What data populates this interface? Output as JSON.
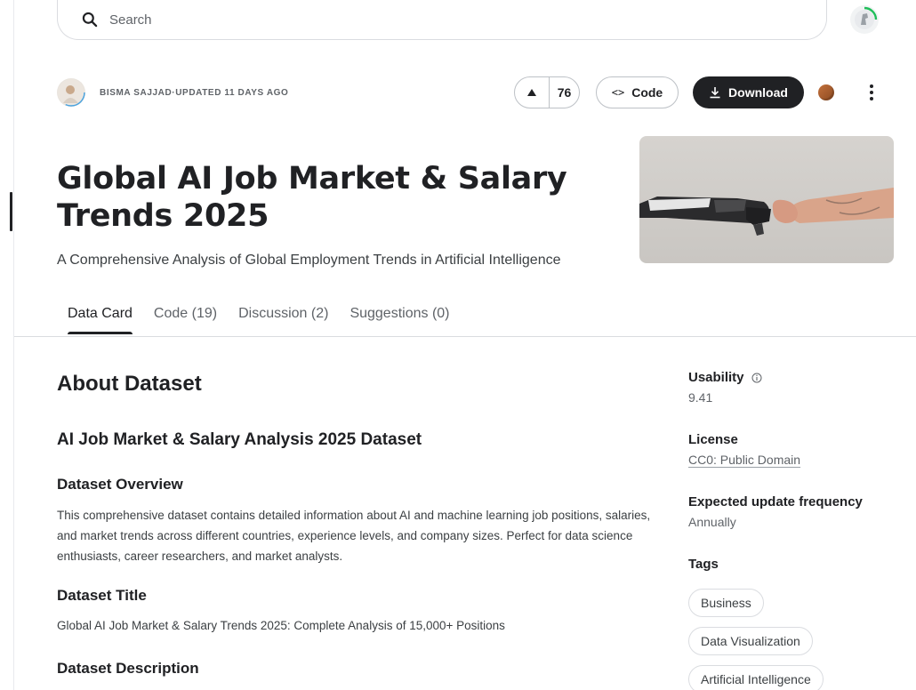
{
  "search": {
    "placeholder": "Search"
  },
  "header": {
    "author": "BISMA SAJJAD",
    "updated": "UPDATED 11 DAYS AGO",
    "separator": " · ",
    "votes": "76",
    "code_label": "Code",
    "download_label": "Download"
  },
  "dataset": {
    "title": "Global AI Job Market & Salary Trends 2025",
    "subtitle": "A Comprehensive Analysis of Global Employment Trends in Artificial Intelligence"
  },
  "tabs": [
    {
      "label": "Data Card",
      "active": true
    },
    {
      "label": "Code (19)",
      "active": false
    },
    {
      "label": "Discussion (2)",
      "active": false
    },
    {
      "label": "Suggestions (0)",
      "active": false
    }
  ],
  "content": {
    "about_heading": "About Dataset",
    "dataset_heading": "AI Job Market & Salary Analysis 2025 Dataset",
    "overview_heading": "Dataset Overview",
    "overview_text": "This comprehensive dataset contains detailed information about AI and machine learning job positions, salaries, and market trends across different countries, experience levels, and company sizes. Perfect for data science enthusiasts, career researchers, and market analysts.",
    "title_heading": "Dataset Title",
    "title_text": "Global AI Job Market & Salary Trends 2025: Complete Analysis of 15,000+ Positions",
    "description_heading": "Dataset Description"
  },
  "sidebar": {
    "usability_label": "Usability",
    "usability_value": "9.41",
    "license_label": "License",
    "license_value": "CC0: Public Domain",
    "frequency_label": "Expected update frequency",
    "frequency_value": "Annually",
    "tags_label": "Tags",
    "tags": [
      "Business",
      "Data Visualization",
      "Artificial Intelligence"
    ]
  },
  "colors": {
    "primary_dark": "#202124",
    "muted_text": "#5f6368",
    "border": "#dadce0"
  }
}
